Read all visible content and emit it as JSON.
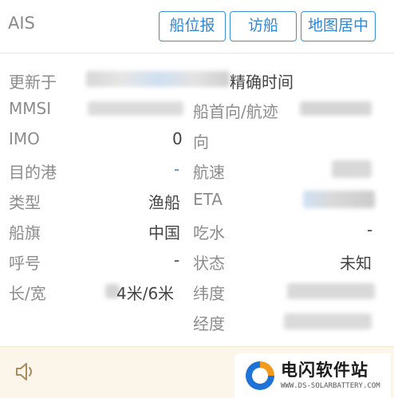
{
  "header": {
    "title": "AIS",
    "buttons": {
      "report": "船位报",
      "visit": "访船",
      "center": "地图居中"
    }
  },
  "info": {
    "updated_label": "更新于",
    "updated_suffix": "精确时间",
    "mmsi_label": "MMSI",
    "imo_label": "IMO",
    "imo_value": "0",
    "destination_label": "目的港",
    "destination_value": "-",
    "type_label": "类型",
    "type_value": "渔船",
    "flag_label": "船旗",
    "flag_value": "中国",
    "callsign_label": "呼号",
    "callsign_value": "-",
    "size_label": "长/宽",
    "size_value": "4米/6米",
    "heading_label": "船首向/航迹",
    "heading_cont": "向",
    "speed_label": "航速",
    "eta_label": "ETA",
    "draft_label": "吃水",
    "draft_value": "-",
    "status_label": "状态",
    "status_value": "未知",
    "lat_label": "纬度",
    "lon_label": "经度"
  },
  "footer": {
    "speaker_icon": "speaker-icon"
  },
  "watermark": {
    "title": "电闪软件站",
    "url": "WWW.DS-SOLARBATTERY.COM",
    "logo_colors": [
      "#1e73d8",
      "#f39a1e"
    ]
  }
}
